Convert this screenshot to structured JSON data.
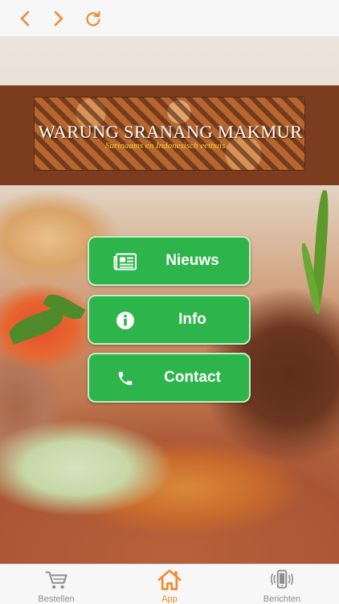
{
  "browser": {
    "back_icon": "chevron-left-icon",
    "forward_icon": "chevron-right-icon",
    "reload_icon": "reload-icon",
    "accent": "#f08a30"
  },
  "logo": {
    "title": "WARUNG SRANANG MAKMUR",
    "subtitle": "Surinaams en Indonesisch eethuis"
  },
  "menu": [
    {
      "label": "Nieuws",
      "icon": "newspaper-icon"
    },
    {
      "label": "Info",
      "icon": "info-icon"
    },
    {
      "label": "Contact",
      "icon": "phone-icon"
    }
  ],
  "menu_color": "#2db44a",
  "tabs": [
    {
      "label": "Bestellen",
      "icon": "cart-icon"
    },
    {
      "label": "App",
      "icon": "home-icon",
      "active": true
    },
    {
      "label": "Berichten",
      "icon": "phone-vibrate-icon"
    }
  ]
}
